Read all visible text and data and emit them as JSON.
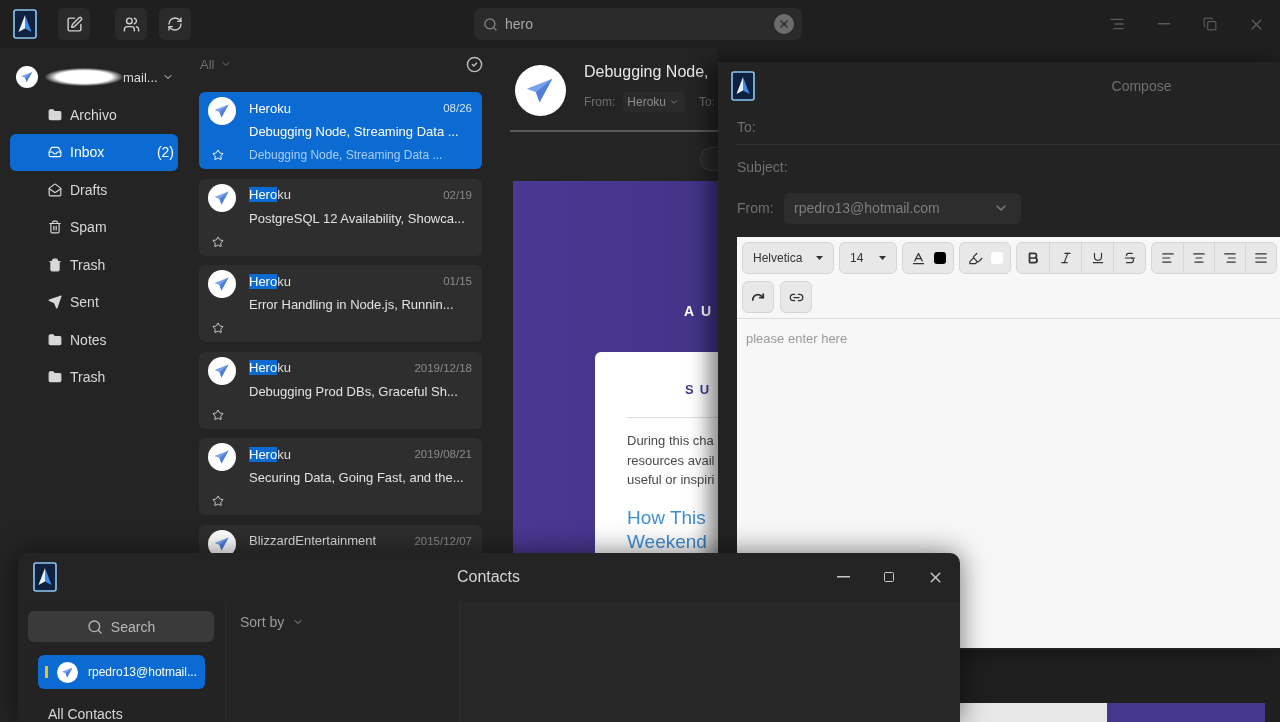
{
  "app_bar": {
    "search": {
      "value": "hero"
    }
  },
  "sidebar": {
    "account": {
      "email": "mail..."
    },
    "folders": [
      {
        "kind": "folder",
        "name": "Archivo",
        "selected": false
      },
      {
        "kind": "inbox",
        "name": "Inbox",
        "count": "(2)",
        "selected": true
      },
      {
        "kind": "drafts",
        "name": "Drafts",
        "selected": false
      },
      {
        "kind": "spam",
        "name": "Spam",
        "selected": false
      },
      {
        "kind": "trash",
        "name": "Trash",
        "selected": false
      },
      {
        "kind": "sent",
        "name": "Sent",
        "selected": false
      },
      {
        "kind": "folder",
        "name": "Notes",
        "selected": false
      },
      {
        "kind": "folder",
        "name": "Trash",
        "selected": false
      }
    ]
  },
  "message_list": {
    "filter": "All",
    "messages": [
      {
        "sender": [
          {
            "text": "Heroku",
            "highlighted": false
          }
        ],
        "date": "08/26",
        "subject": "Debugging Node, Streaming Data ...",
        "preview": "Debugging Node, Streaming Data ...",
        "selected": true,
        "starred": false
      },
      {
        "sender": [
          {
            "text": "Hero",
            "highlighted": true
          },
          {
            "text": "ku",
            "highlighted": false
          }
        ],
        "date": "02/19",
        "subject": "PostgreSQL 12 Availability, Showca...",
        "selected": false,
        "starred": false
      },
      {
        "sender": [
          {
            "text": "Hero",
            "highlighted": true
          },
          {
            "text": "ku",
            "highlighted": false
          }
        ],
        "date": "01/15",
        "subject": "Error Handling in Node.js, Runnin...",
        "selected": false,
        "starred": false
      },
      {
        "sender": [
          {
            "text": "Hero",
            "highlighted": true
          },
          {
            "text": "ku",
            "highlighted": false
          }
        ],
        "date": "2019/12/18",
        "subject": "Debugging Prod DBs, Graceful Sh...",
        "selected": false,
        "starred": false
      },
      {
        "sender": [
          {
            "text": "Hero",
            "highlighted": true
          },
          {
            "text": "ku",
            "highlighted": false
          }
        ],
        "date": "2019/08/21",
        "subject": "Securing Data, Going Fast, and the...",
        "selected": false,
        "starred": false
      },
      {
        "sender": [
          {
            "text": "BlizzardEntertainment",
            "highlighted": false
          }
        ],
        "date": "2015/12/07",
        "selected": false
      }
    ]
  },
  "reading_pane": {
    "subject": "Debugging Node,",
    "from_label": "From:",
    "from": "Heroku",
    "to_label": "To:",
    "email": {
      "banner_heading": "AU",
      "card_heading": "SU",
      "paragraph_lines": [
        "During this cha",
        "resources avail",
        "useful or inspiri"
      ],
      "link_lines": [
        "How This",
        "Weekend"
      ]
    }
  },
  "compose_window": {
    "title": "Compose",
    "to_label": "To:",
    "subject_label": "Subject:",
    "from_label": "From:",
    "from": "rpedro13@hotmail.com",
    "toolbar": {
      "font": "Helvetica",
      "size": "14"
    },
    "body_placeholder": "please enter here"
  },
  "contacts_window": {
    "title": "Contacts",
    "search": "Search",
    "accounts": [
      {
        "email": "rpedro13@hotmail...",
        "selected": true
      }
    ],
    "groups": [
      "All Contacts"
    ],
    "sort_label": "Sort by"
  }
}
